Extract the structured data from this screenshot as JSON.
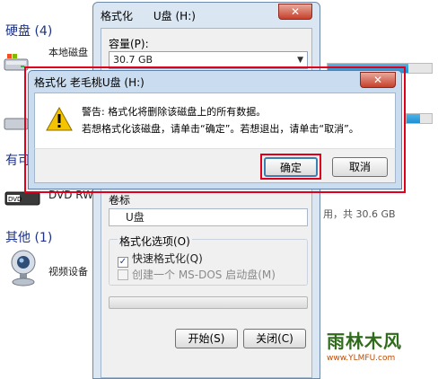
{
  "explorer": {
    "hard_disks_group": "硬盘 (4)",
    "local_disk_label": "本地磁盘",
    "removable_group_partial": "有可",
    "dvd_label": "DVD RW",
    "free_space_text": "用，共 30.6 GB",
    "other_group": "其他 (1)",
    "video_device_label": "视频设备",
    "disk_usage_fraction": 0.78,
    "disk2_usage_fraction": 0.55,
    "icons": [
      "hard-drive-icon",
      "dvd-drive-icon",
      "webcam-icon"
    ]
  },
  "format_window": {
    "title": "格式化      U盘 (H:)",
    "close_glyph": "✕",
    "capacity_label": "容量(P):",
    "capacity_value": "30.7 GB",
    "volume_label_label": "卷标",
    "volume_label_value": "U盘",
    "format_options_label": "格式化选项(O)",
    "quick_format_label": "快速格式化(Q)",
    "quick_format_checked": true,
    "quick_format_check_glyph": "✓",
    "msdos_label": "创建一个 MS-DOS 启动盘(M)",
    "msdos_checked": false,
    "start_button": "开始(S)",
    "close_button": "关闭(C)"
  },
  "warning_dialog": {
    "title": "格式化 老毛桃U盘 (H:)",
    "close_glyph": "✕",
    "icon": "warning-icon",
    "line1": "警告: 格式化将删除该磁盘上的所有数据。",
    "line2": "若想格式化该磁盘，请单击“确定”。若想退出，请单击“取消”。",
    "ok_button": "确定",
    "cancel_button": "取消"
  },
  "watermark": {
    "main": "雨林木风",
    "sub": "www.YLMFU.com"
  },
  "colors": {
    "highlight_outline": "#e0001b",
    "group_heading": "#1e3287",
    "window_frame": "#dbe6f3"
  }
}
